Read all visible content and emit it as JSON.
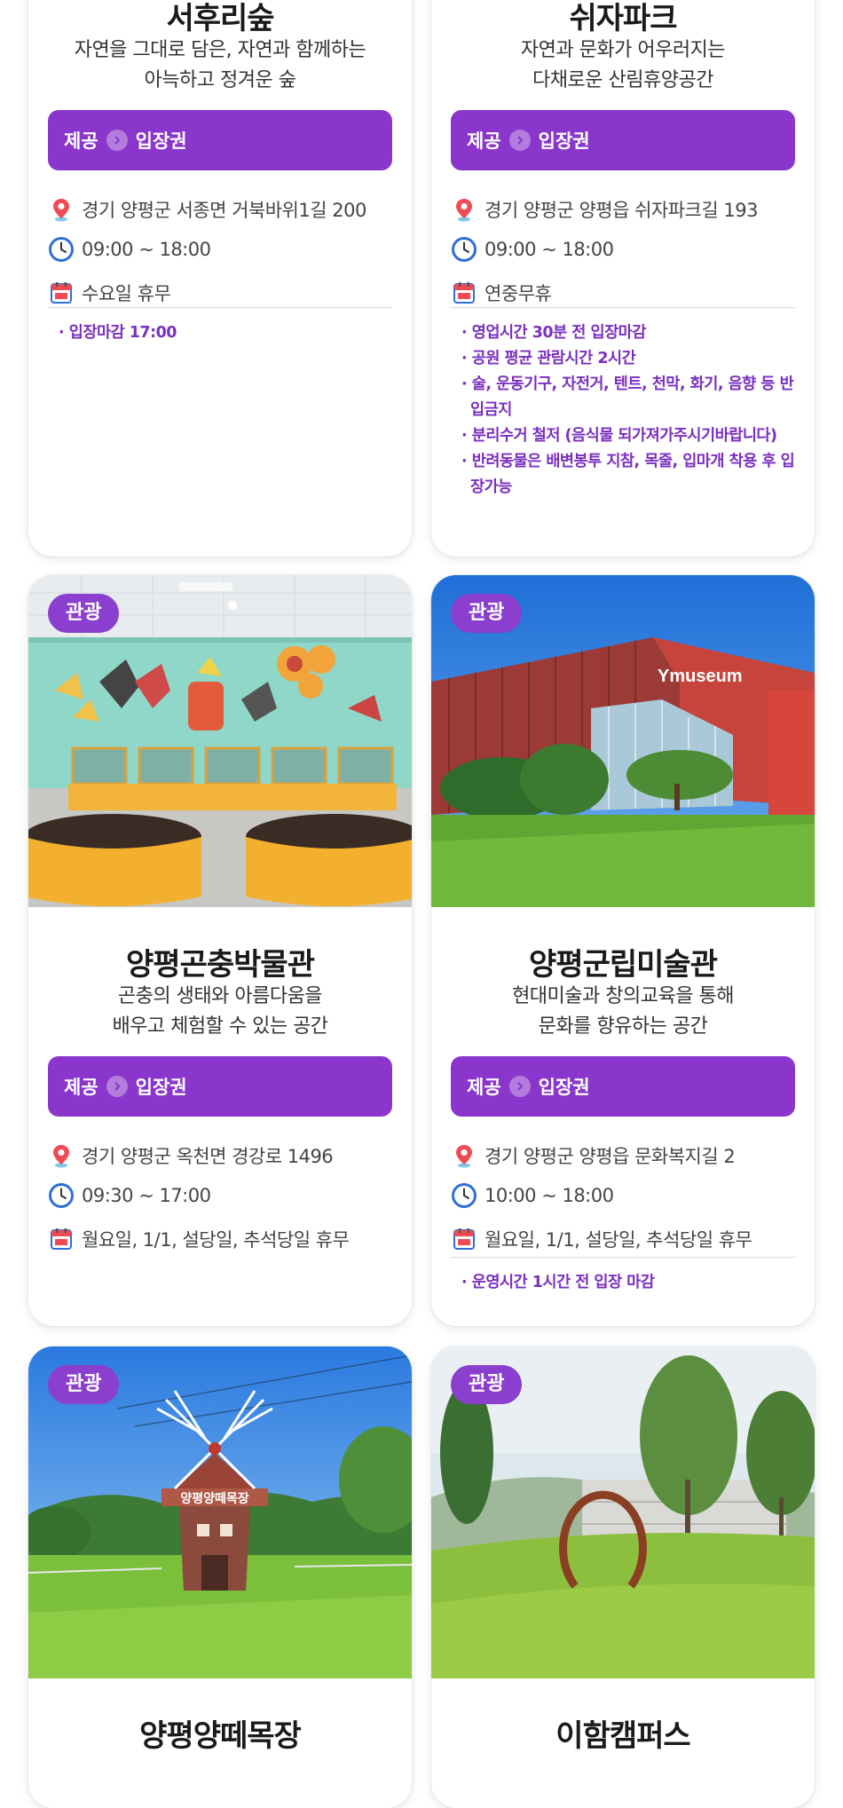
{
  "colors": {
    "accent": "#8a36cc",
    "note_text": "#7a2fc0",
    "badge": "#8a3fcf"
  },
  "provide_label": "제공",
  "arrow_icon": "chevron-right-circle-icon",
  "icons": {
    "location": "map-pin-icon",
    "hours": "clock-icon",
    "closed": "calendar-day-icon"
  },
  "cards": [
    {
      "name": "서후리숲",
      "desc_lines": [
        "자연을 그대로 담은, 자연과 함께하는",
        "아늑하고 정겨운 숲"
      ],
      "provide_value": "입장권",
      "address": "경기 양평군 서종면 거북바위1길 200",
      "hours": "09:00 ~ 18:00",
      "closed": "수요일 휴무",
      "notes": [
        "· 입장마감 17:00"
      ]
    },
    {
      "name": "쉬자파크",
      "desc_lines": [
        "자연과 문화가 어우러지는",
        "다채로운 산림휴양공간"
      ],
      "provide_value": "입장권",
      "address": "경기 양평군 양평읍 쉬자파크길 193",
      "hours": "09:00 ~ 18:00",
      "closed": "연중무휴",
      "notes": [
        "· 영업시간 30분 전 입장마감",
        "· 공원 평균 관람시간 2시간",
        "· 술, 운동기구, 자전거, 텐트, 천막, 화기, 음향 등 반입금지",
        "· 분리수거 철저 (음식물 되가져가주시기바랍니다)",
        "· 반려동물은 배변봉투 지참, 목줄, 입마개 착용 후 입장가능"
      ]
    },
    {
      "badge": "관광",
      "name": "양평곤충박물관",
      "desc_lines": [
        "곤충의 생태와 아름다움을",
        "배우고 체험할 수 있는 공간"
      ],
      "provide_value": "입장권",
      "address": "경기 양평군 옥천면 경강로 1496",
      "hours": "09:30 ~ 17:00",
      "closed": "월요일, 1/1, 설당일, 추석당일 휴무",
      "notes": []
    },
    {
      "badge": "관광",
      "name": "양평군립미술관",
      "desc_lines": [
        "현대미술과 창의교육을 통해",
        "문화를 향유하는 공간"
      ],
      "provide_value": "입장권",
      "address": "경기 양평군 양평읍 문화복지길 2",
      "hours": "10:00 ~ 18:00",
      "closed": "월요일, 1/1, 설당일, 추석당일 휴무",
      "notes": [
        "· 운영시간 1시간 전 입장 마감"
      ],
      "photo_sign": "Ymuseum"
    },
    {
      "badge": "관광",
      "name": "양평양떼목장",
      "photo_sign": "양평양떼목장"
    },
    {
      "badge": "관광",
      "name": "이함캠퍼스"
    }
  ]
}
